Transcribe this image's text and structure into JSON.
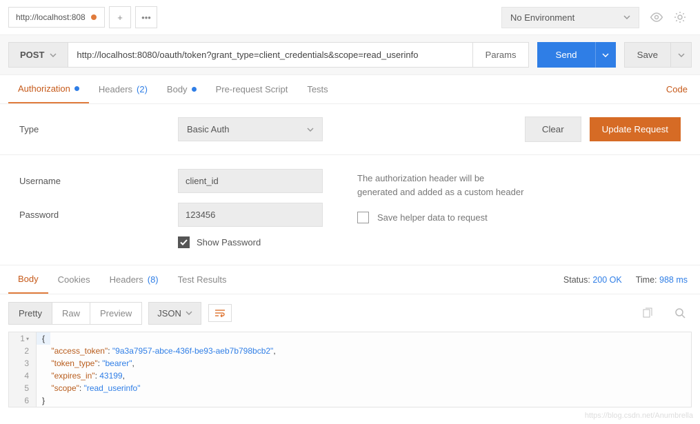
{
  "topbar": {
    "tab_title": "http://localhost:808"
  },
  "env": {
    "label": "No Environment"
  },
  "request": {
    "method": "POST",
    "url": "http://localhost:8080/oauth/token?grant_type=client_credentials&scope=read_userinfo",
    "params_label": "Params",
    "send_label": "Send",
    "save_label": "Save"
  },
  "request_tabs": {
    "authorization": "Authorization",
    "headers": "Headers",
    "headers_count": "(2)",
    "body": "Body",
    "prerequest": "Pre-request Script",
    "tests": "Tests",
    "code_link": "Code"
  },
  "auth": {
    "type_label": "Type",
    "type_value": "Basic Auth",
    "clear": "Clear",
    "update": "Update Request",
    "username_label": "Username",
    "username_value": "client_id",
    "password_label": "Password",
    "password_value": "123456",
    "show_password": "Show Password",
    "info1": "The authorization header will be",
    "info2": "generated and added as a custom header",
    "save_helper": "Save helper data to request"
  },
  "response_tabs": {
    "body": "Body",
    "cookies": "Cookies",
    "headers": "Headers",
    "headers_count": "(8)",
    "test_results": "Test Results"
  },
  "status": {
    "status_label": "Status:",
    "status_value": "200 OK",
    "time_label": "Time:",
    "time_value": "988 ms"
  },
  "view": {
    "pretty": "Pretty",
    "raw": "Raw",
    "preview": "Preview",
    "format": "JSON"
  },
  "response_body": {
    "l1": "{",
    "l2_key": "\"access_token\"",
    "l2_val": "\"9a3a7957-abce-436f-be93-aeb7b798bcb2\"",
    "l3_key": "\"token_type\"",
    "l3_val": "\"bearer\"",
    "l4_key": "\"expires_in\"",
    "l4_val": "43199",
    "l5_key": "\"scope\"",
    "l5_val": "\"read_userinfo\"",
    "l6": "}"
  },
  "watermark": "https://blog.csdn.net/Anumbrella"
}
